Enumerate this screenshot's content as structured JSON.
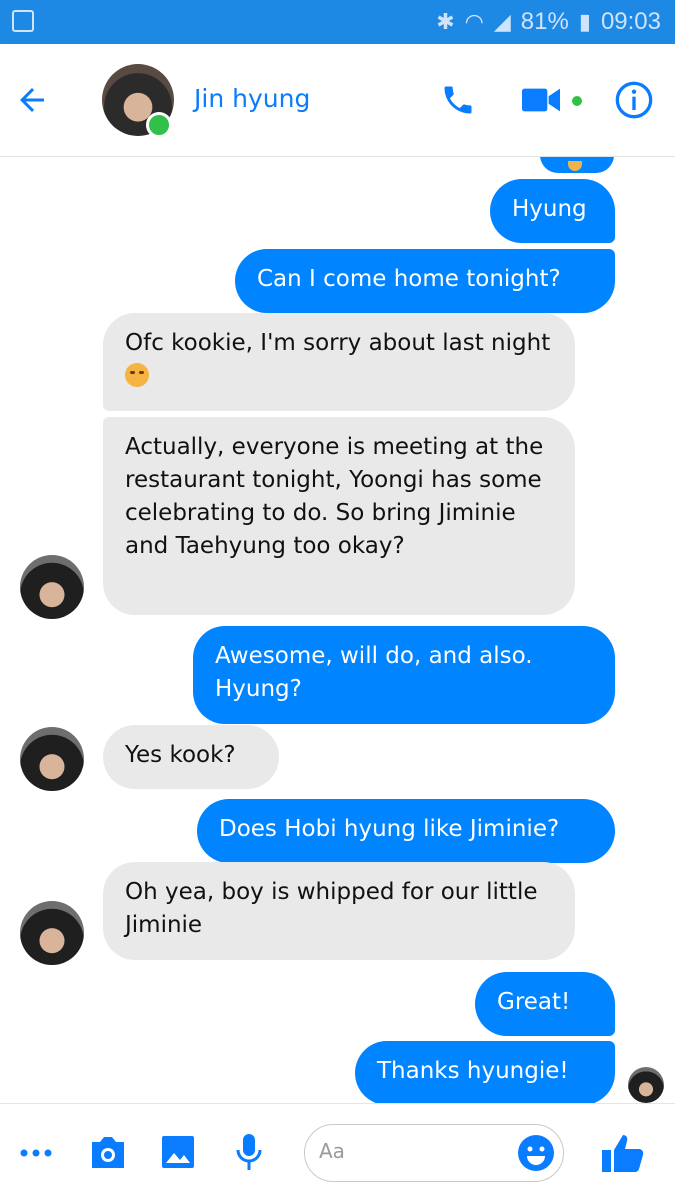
{
  "status_bar": {
    "battery": "81%",
    "time": "09:03"
  },
  "header": {
    "contact_name": "Jin hyung"
  },
  "messages": [
    {
      "from": "me",
      "text": "Hyung"
    },
    {
      "from": "me",
      "text": "Can I come home tonight?"
    },
    {
      "from": "them",
      "text": "Ofc kookie, I'm sorry about last night"
    },
    {
      "from": "them",
      "text": "Actually, everyone is meeting at the restaurant tonight, Yoongi has some celebrating to do. So bring Jiminie and Taehyung too okay?"
    },
    {
      "from": "me",
      "text": "Awesome, will do, and also. Hyung?"
    },
    {
      "from": "them",
      "text": "Yes kook?"
    },
    {
      "from": "me",
      "text": "Does Hobi hyung like Jiminie?"
    },
    {
      "from": "them",
      "text": "Oh yea, boy is whipped for our little Jiminie"
    },
    {
      "from": "me",
      "text": "Great!"
    },
    {
      "from": "me",
      "text": "Thanks hyungie!"
    }
  ],
  "composer": {
    "placeholder": "Aa"
  },
  "colors": {
    "accent": "#0a7cff",
    "outgoing_bubble": "#0084ff",
    "incoming_bubble": "#e9e9e9",
    "online": "#31c14a",
    "status_bar": "#1e88e5"
  },
  "icons": [
    "back-arrow-icon",
    "phone-icon",
    "video-camera-icon",
    "info-icon",
    "more-icon",
    "camera-icon",
    "gallery-icon",
    "microphone-icon",
    "emoji-icon",
    "thumbs-up-icon"
  ]
}
